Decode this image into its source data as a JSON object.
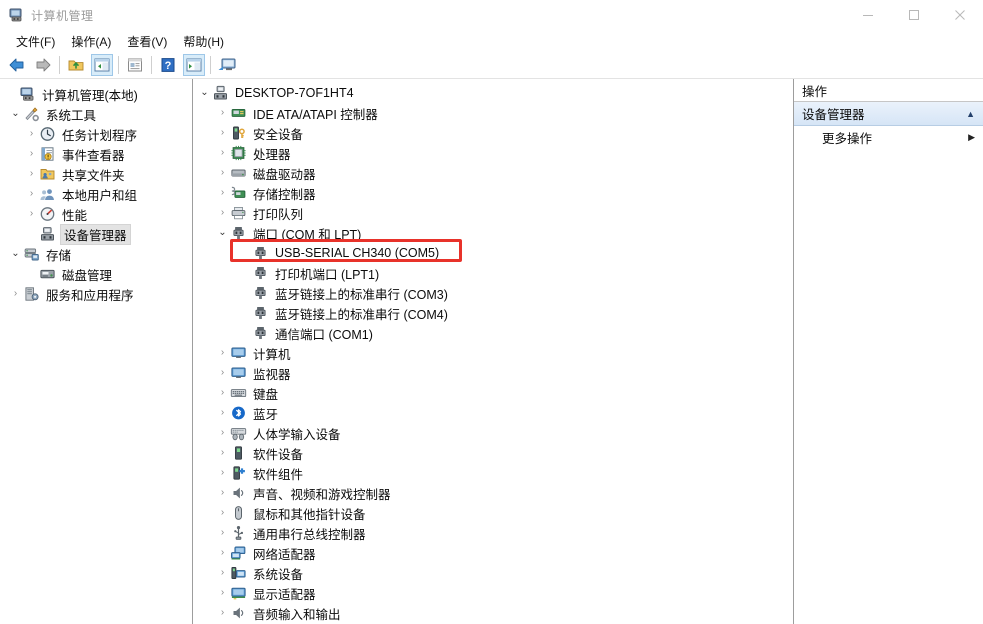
{
  "window": {
    "title": "计算机管理",
    "app_icon": "computer-management-icon",
    "minimize": "–",
    "maximize": "□",
    "close": "✕"
  },
  "menubar": {
    "items": [
      {
        "label": "文件(F)",
        "name": "menu-file"
      },
      {
        "label": "操作(A)",
        "name": "menu-action"
      },
      {
        "label": "查看(V)",
        "name": "menu-view"
      },
      {
        "label": "帮助(H)",
        "name": "menu-help"
      }
    ]
  },
  "toolbar": {
    "buttons": [
      {
        "icon": "back-arrow-icon",
        "active": false
      },
      {
        "icon": "forward-arrow-icon",
        "active": false
      },
      {
        "icon": "separator",
        "active": false
      },
      {
        "icon": "up-folder-icon",
        "active": false
      },
      {
        "icon": "show-tree-icon",
        "active": true
      },
      {
        "icon": "separator",
        "active": false
      },
      {
        "icon": "properties-icon",
        "active": false
      },
      {
        "icon": "separator",
        "active": false
      },
      {
        "icon": "help-icon",
        "active": false
      },
      {
        "icon": "show-action-pane-icon",
        "active": true
      },
      {
        "icon": "separator",
        "active": false
      },
      {
        "icon": "console-icon",
        "active": false
      }
    ]
  },
  "console_tree": {
    "root": {
      "label": "计算机管理(本地)",
      "icon": "computer-icon",
      "indent": 0,
      "expander": "none"
    },
    "items": [
      {
        "label": "计算机管理(本地)",
        "icon": "computer-icon",
        "indent": 0,
        "expander": "none",
        "selected": false
      },
      {
        "label": "系统工具",
        "icon": "tools-icon",
        "indent": 1,
        "expander": "down",
        "selected": false
      },
      {
        "label": "任务计划程序",
        "icon": "clock-icon",
        "indent": 2,
        "expander": "right",
        "selected": false
      },
      {
        "label": "事件查看器",
        "icon": "event-log-icon",
        "indent": 2,
        "expander": "right",
        "selected": false
      },
      {
        "label": "共享文件夹",
        "icon": "shared-folder-icon",
        "indent": 2,
        "expander": "right",
        "selected": false
      },
      {
        "label": "本地用户和组",
        "icon": "users-icon",
        "indent": 2,
        "expander": "right",
        "selected": false
      },
      {
        "label": "性能",
        "icon": "performance-icon",
        "indent": 2,
        "expander": "right",
        "selected": false
      },
      {
        "label": "设备管理器",
        "icon": "device-manager-icon",
        "indent": 2,
        "expander": "none",
        "selected": true
      },
      {
        "label": "存储",
        "icon": "storage-icon",
        "indent": 1,
        "expander": "down",
        "selected": false
      },
      {
        "label": "磁盘管理",
        "icon": "disk-management-icon",
        "indent": 2,
        "expander": "none",
        "selected": false
      },
      {
        "label": "服务和应用程序",
        "icon": "services-icon",
        "indent": 1,
        "expander": "right",
        "selected": false
      }
    ]
  },
  "device_tree": {
    "items": [
      {
        "label": "DESKTOP-7OF1HT4",
        "icon": "computer-node-icon",
        "indent": 0,
        "expander": "down",
        "highlight": false
      },
      {
        "label": "IDE ATA/ATAPI 控制器",
        "icon": "ide-controller-icon",
        "indent": 1,
        "expander": "right",
        "highlight": false
      },
      {
        "label": "安全设备",
        "icon": "security-device-icon",
        "indent": 1,
        "expander": "right",
        "highlight": false
      },
      {
        "label": "处理器",
        "icon": "processor-icon",
        "indent": 1,
        "expander": "right",
        "highlight": false
      },
      {
        "label": "磁盘驱动器",
        "icon": "disk-drive-icon",
        "indent": 1,
        "expander": "right",
        "highlight": false
      },
      {
        "label": "存储控制器",
        "icon": "storage-controller-icon",
        "indent": 1,
        "expander": "right",
        "highlight": false
      },
      {
        "label": "打印队列",
        "icon": "print-queue-icon",
        "indent": 1,
        "expander": "right",
        "highlight": false
      },
      {
        "label": "端口 (COM 和 LPT)",
        "icon": "port-icon",
        "indent": 1,
        "expander": "down",
        "highlight": false
      },
      {
        "label": "USB-SERIAL CH340 (COM5)",
        "icon": "port-icon",
        "indent": 2,
        "expander": "none",
        "highlight": true
      },
      {
        "label": "打印机端口 (LPT1)",
        "icon": "port-icon",
        "indent": 2,
        "expander": "none",
        "highlight": false
      },
      {
        "label": "蓝牙链接上的标准串行 (COM3)",
        "icon": "port-icon",
        "indent": 2,
        "expander": "none",
        "highlight": false
      },
      {
        "label": "蓝牙链接上的标准串行 (COM4)",
        "icon": "port-icon",
        "indent": 2,
        "expander": "none",
        "highlight": false
      },
      {
        "label": "通信端口 (COM1)",
        "icon": "port-icon",
        "indent": 2,
        "expander": "none",
        "highlight": false
      },
      {
        "label": "计算机",
        "icon": "monitor-icon",
        "indent": 1,
        "expander": "right",
        "highlight": false
      },
      {
        "label": "监视器",
        "icon": "monitor-icon",
        "indent": 1,
        "expander": "right",
        "highlight": false
      },
      {
        "label": "键盘",
        "icon": "keyboard-icon",
        "indent": 1,
        "expander": "right",
        "highlight": false
      },
      {
        "label": "蓝牙",
        "icon": "bluetooth-icon",
        "indent": 1,
        "expander": "right",
        "highlight": false
      },
      {
        "label": "人体学输入设备",
        "icon": "hid-icon",
        "indent": 1,
        "expander": "right",
        "highlight": false
      },
      {
        "label": "软件设备",
        "icon": "software-device-icon",
        "indent": 1,
        "expander": "right",
        "highlight": false
      },
      {
        "label": "软件组件",
        "icon": "software-component-icon",
        "indent": 1,
        "expander": "right",
        "highlight": false
      },
      {
        "label": "声音、视频和游戏控制器",
        "icon": "sound-icon",
        "indent": 1,
        "expander": "right",
        "highlight": false
      },
      {
        "label": "鼠标和其他指针设备",
        "icon": "mouse-icon",
        "indent": 1,
        "expander": "right",
        "highlight": false
      },
      {
        "label": "通用串行总线控制器",
        "icon": "usb-icon",
        "indent": 1,
        "expander": "right",
        "highlight": false
      },
      {
        "label": "网络适配器",
        "icon": "network-adapter-icon",
        "indent": 1,
        "expander": "right",
        "highlight": false
      },
      {
        "label": "系统设备",
        "icon": "system-device-icon",
        "indent": 1,
        "expander": "right",
        "highlight": false
      },
      {
        "label": "显示适配器",
        "icon": "display-adapter-icon",
        "indent": 1,
        "expander": "right",
        "highlight": false
      },
      {
        "label": "音频输入和输出",
        "icon": "audio-io-icon",
        "indent": 1,
        "expander": "right",
        "highlight": false
      }
    ]
  },
  "actions_pane": {
    "header": "操作",
    "section_title": "设备管理器",
    "section_caret": "▲",
    "items": [
      {
        "label": "更多操作",
        "arrow": "▶"
      }
    ]
  },
  "annotation": {
    "highlight_color": "#e8322a",
    "highlighted_device": "USB-SERIAL CH340 (COM5)"
  },
  "colors": {
    "selection_bg": "#e3e3e3",
    "action_header_bg": "#d6e5f6",
    "divider": "#9d9d9d",
    "title_text": "#9b9b9b"
  }
}
